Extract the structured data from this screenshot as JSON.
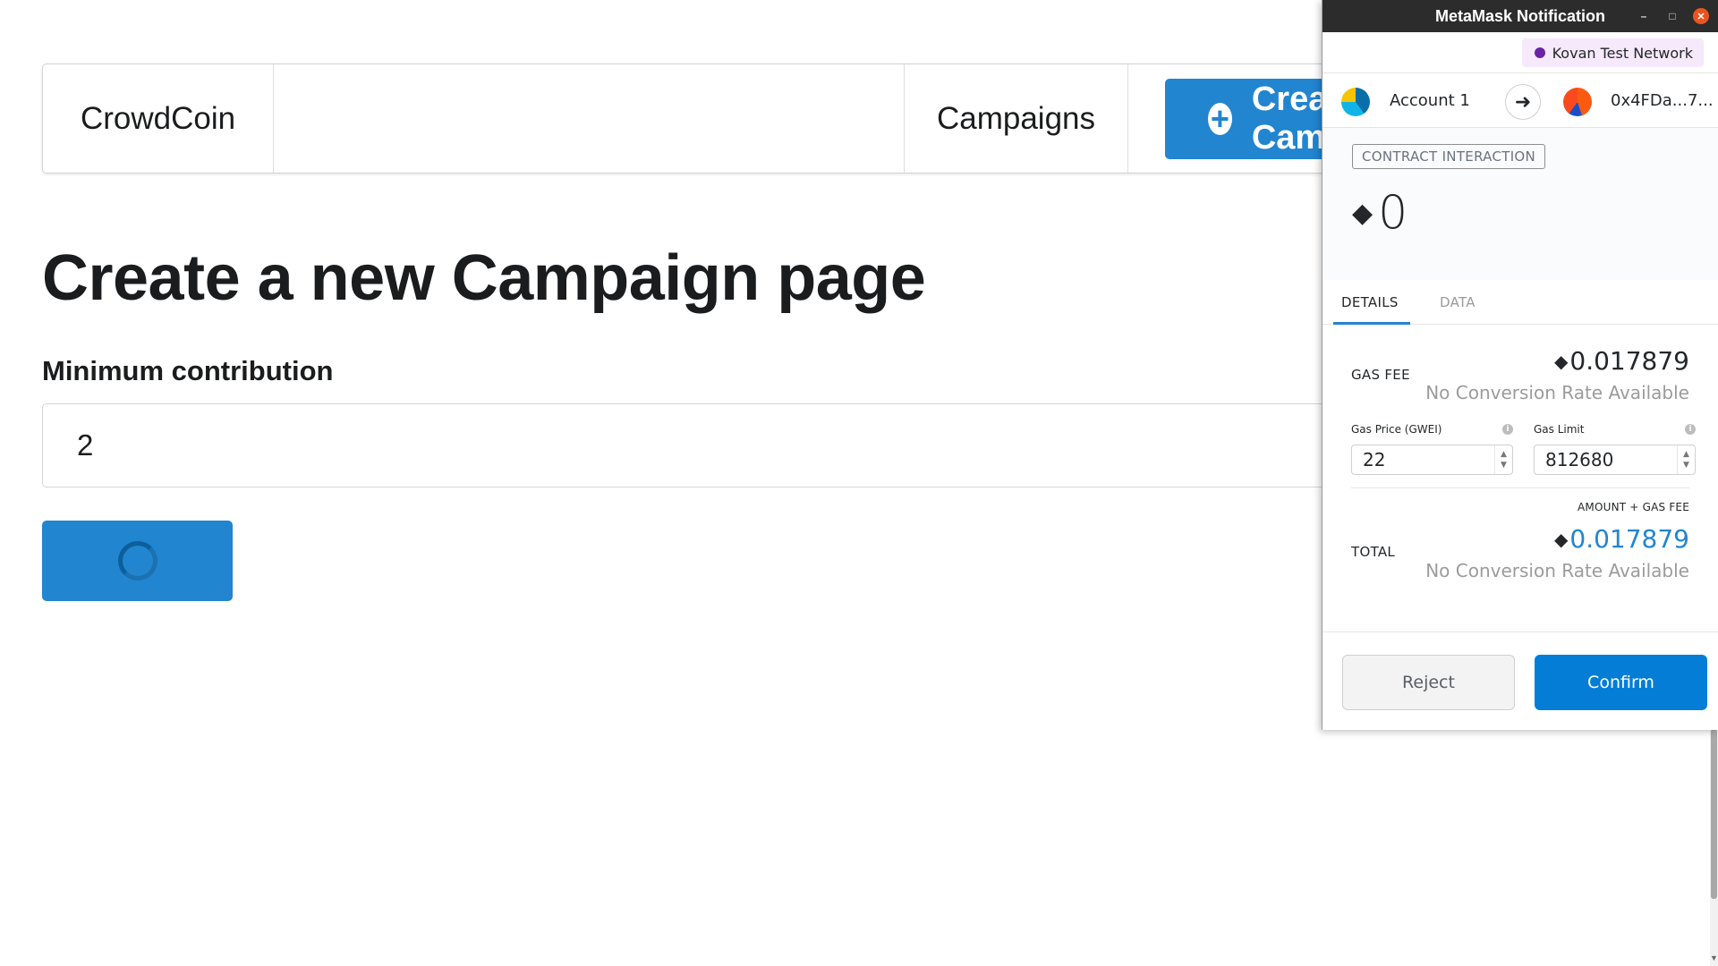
{
  "app": {
    "brand": "CrowdCoin",
    "nav_campaigns": "Campaigns",
    "create_button": "Create Campaign",
    "page_title": "Create a new Campaign page",
    "min_contribution_label": "Minimum contribution",
    "min_contribution_value": "2"
  },
  "metamask": {
    "window_title": "MetaMask Notification",
    "network": "Kovan Test Network",
    "from_account": "Account 1",
    "to_account": "0x4FDa...7...",
    "badge": "CONTRACT INTERACTION",
    "eth_amount": "0",
    "tabs": {
      "details": "DETAILS",
      "data": "DATA"
    },
    "gas_fee_label": "GAS FEE",
    "gas_fee_value": "0.017879",
    "no_conversion": "No Conversion Rate Available",
    "gas_price_label": "Gas Price (GWEI)",
    "gas_price_value": "22",
    "gas_limit_label": "Gas Limit",
    "gas_limit_value": "812680",
    "total_caption": "AMOUNT + GAS FEE",
    "total_label": "TOTAL",
    "total_value": "0.017879",
    "reject": "Reject",
    "confirm": "Confirm"
  },
  "colors": {
    "primary_blue": "#2185d0",
    "metamask_blue": "#037dd6",
    "titlebar": "#2c2c2c",
    "network_dot": "#6a23a5"
  },
  "icons": {
    "plus": "plus-circle-icon",
    "arrow": "arrow-right-icon",
    "eth": "ethereum-icon",
    "info": "info-icon"
  }
}
